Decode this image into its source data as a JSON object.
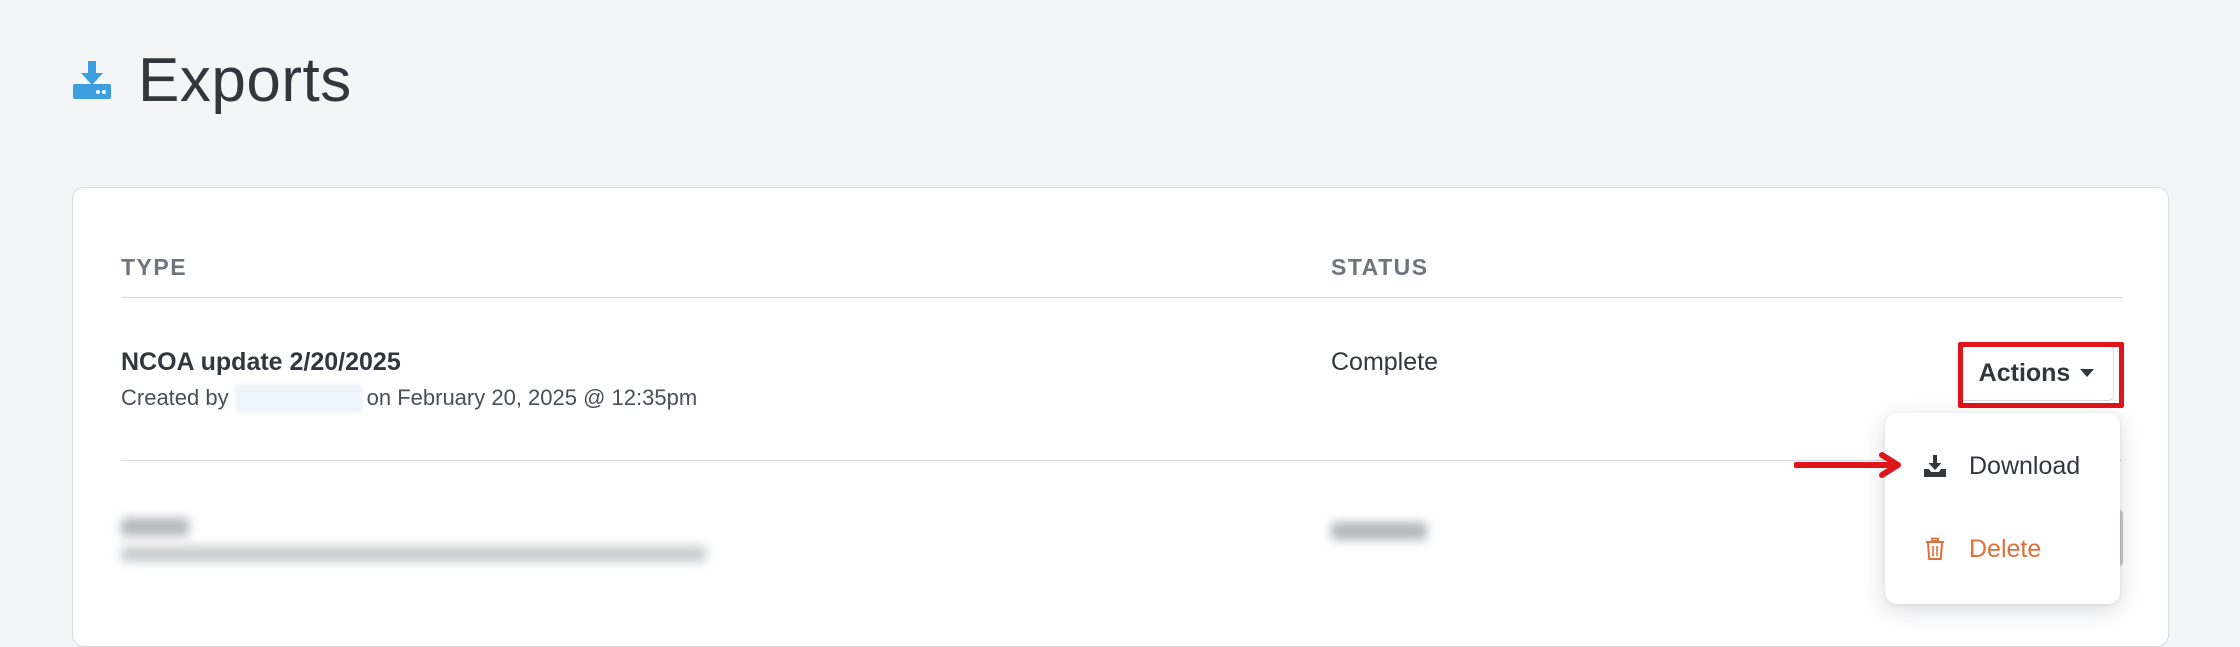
{
  "header": {
    "title": "Exports",
    "icon": "download-icon",
    "icon_color": "#3d9ee0"
  },
  "table": {
    "columns": {
      "type": "TYPE",
      "status": "STATUS"
    },
    "rows": [
      {
        "title": "NCOA update 2/20/2025",
        "created_by_prefix": "Created by",
        "created_on": "on February 20, 2025 @ 12:35pm",
        "status": "Complete"
      }
    ]
  },
  "actions": {
    "label": "Actions",
    "menu": [
      {
        "label": "Download",
        "icon": "download-tray-icon",
        "color": "#33373d"
      },
      {
        "label": "Delete",
        "icon": "trash-icon",
        "color": "#e07038"
      }
    ]
  },
  "colors": {
    "background": "#f4f5f7",
    "annotation": "#e0141b",
    "danger": "#e07038"
  }
}
